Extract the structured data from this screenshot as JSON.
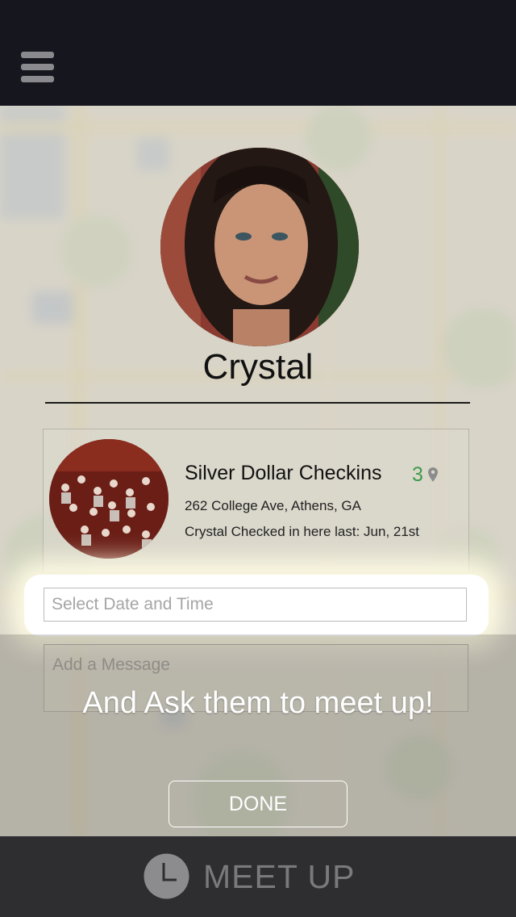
{
  "header": {
    "menu_icon": "hamburger-menu-icon"
  },
  "profile": {
    "name": "Crystal"
  },
  "venue": {
    "name": "Silver Dollar Checkins",
    "checkin_count": "3",
    "address": "262 College Ave, Athens, GA",
    "last_checkin": "Crystal Checked in here last: Jun, 21st"
  },
  "form": {
    "date_placeholder": "Select Date and Time",
    "message_placeholder": "Add a Message"
  },
  "tutorial": {
    "text": "And Ask them to meet up!",
    "done_label": "DONE"
  },
  "footer": {
    "label": "MEET UP",
    "icon": "clock-icon"
  },
  "colors": {
    "topbar": "#16161e",
    "count_green": "#3c9a4a",
    "footer": "#2e2e30"
  }
}
